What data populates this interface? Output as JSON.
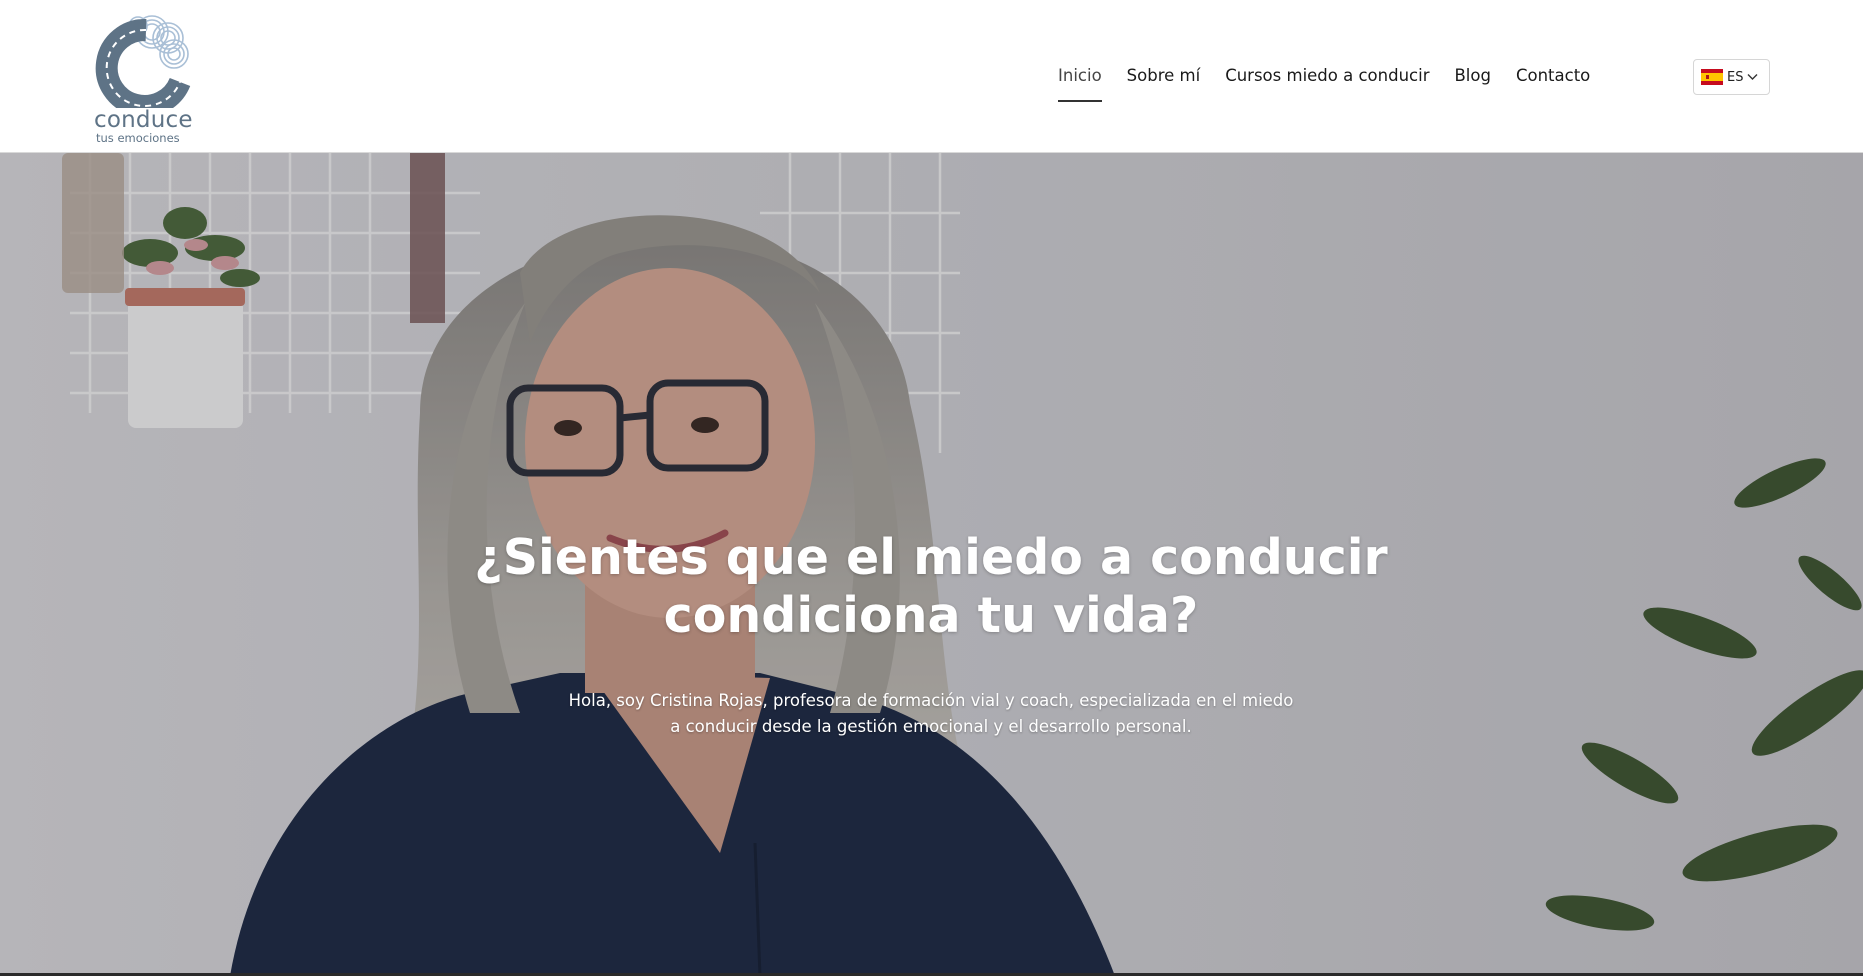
{
  "brand": {
    "name": "conduce",
    "tagline": "tus emociones",
    "colors": {
      "logo": "#5e7386",
      "logo_accent": "#a9bfd6"
    }
  },
  "nav": {
    "items": [
      {
        "label": "Inicio",
        "active": true
      },
      {
        "label": "Sobre mí",
        "active": false
      },
      {
        "label": "Cursos miedo a conducir",
        "active": false
      },
      {
        "label": "Blog",
        "active": false
      },
      {
        "label": "Contacto",
        "active": false
      }
    ]
  },
  "language": {
    "code": "ES",
    "flag_icon": "spain-flag-icon",
    "dropdown_icon": "chevron-down-icon"
  },
  "hero": {
    "title": "¿Sientes que el miedo a conducir condiciona tu vida?",
    "text": "Hola, soy Cristina Rojas, profesora de formación vial y coach, especializada en el miedo a conducir desde la gestión emocional y el desarrollo personal.",
    "image": "woman-portrait-background"
  }
}
